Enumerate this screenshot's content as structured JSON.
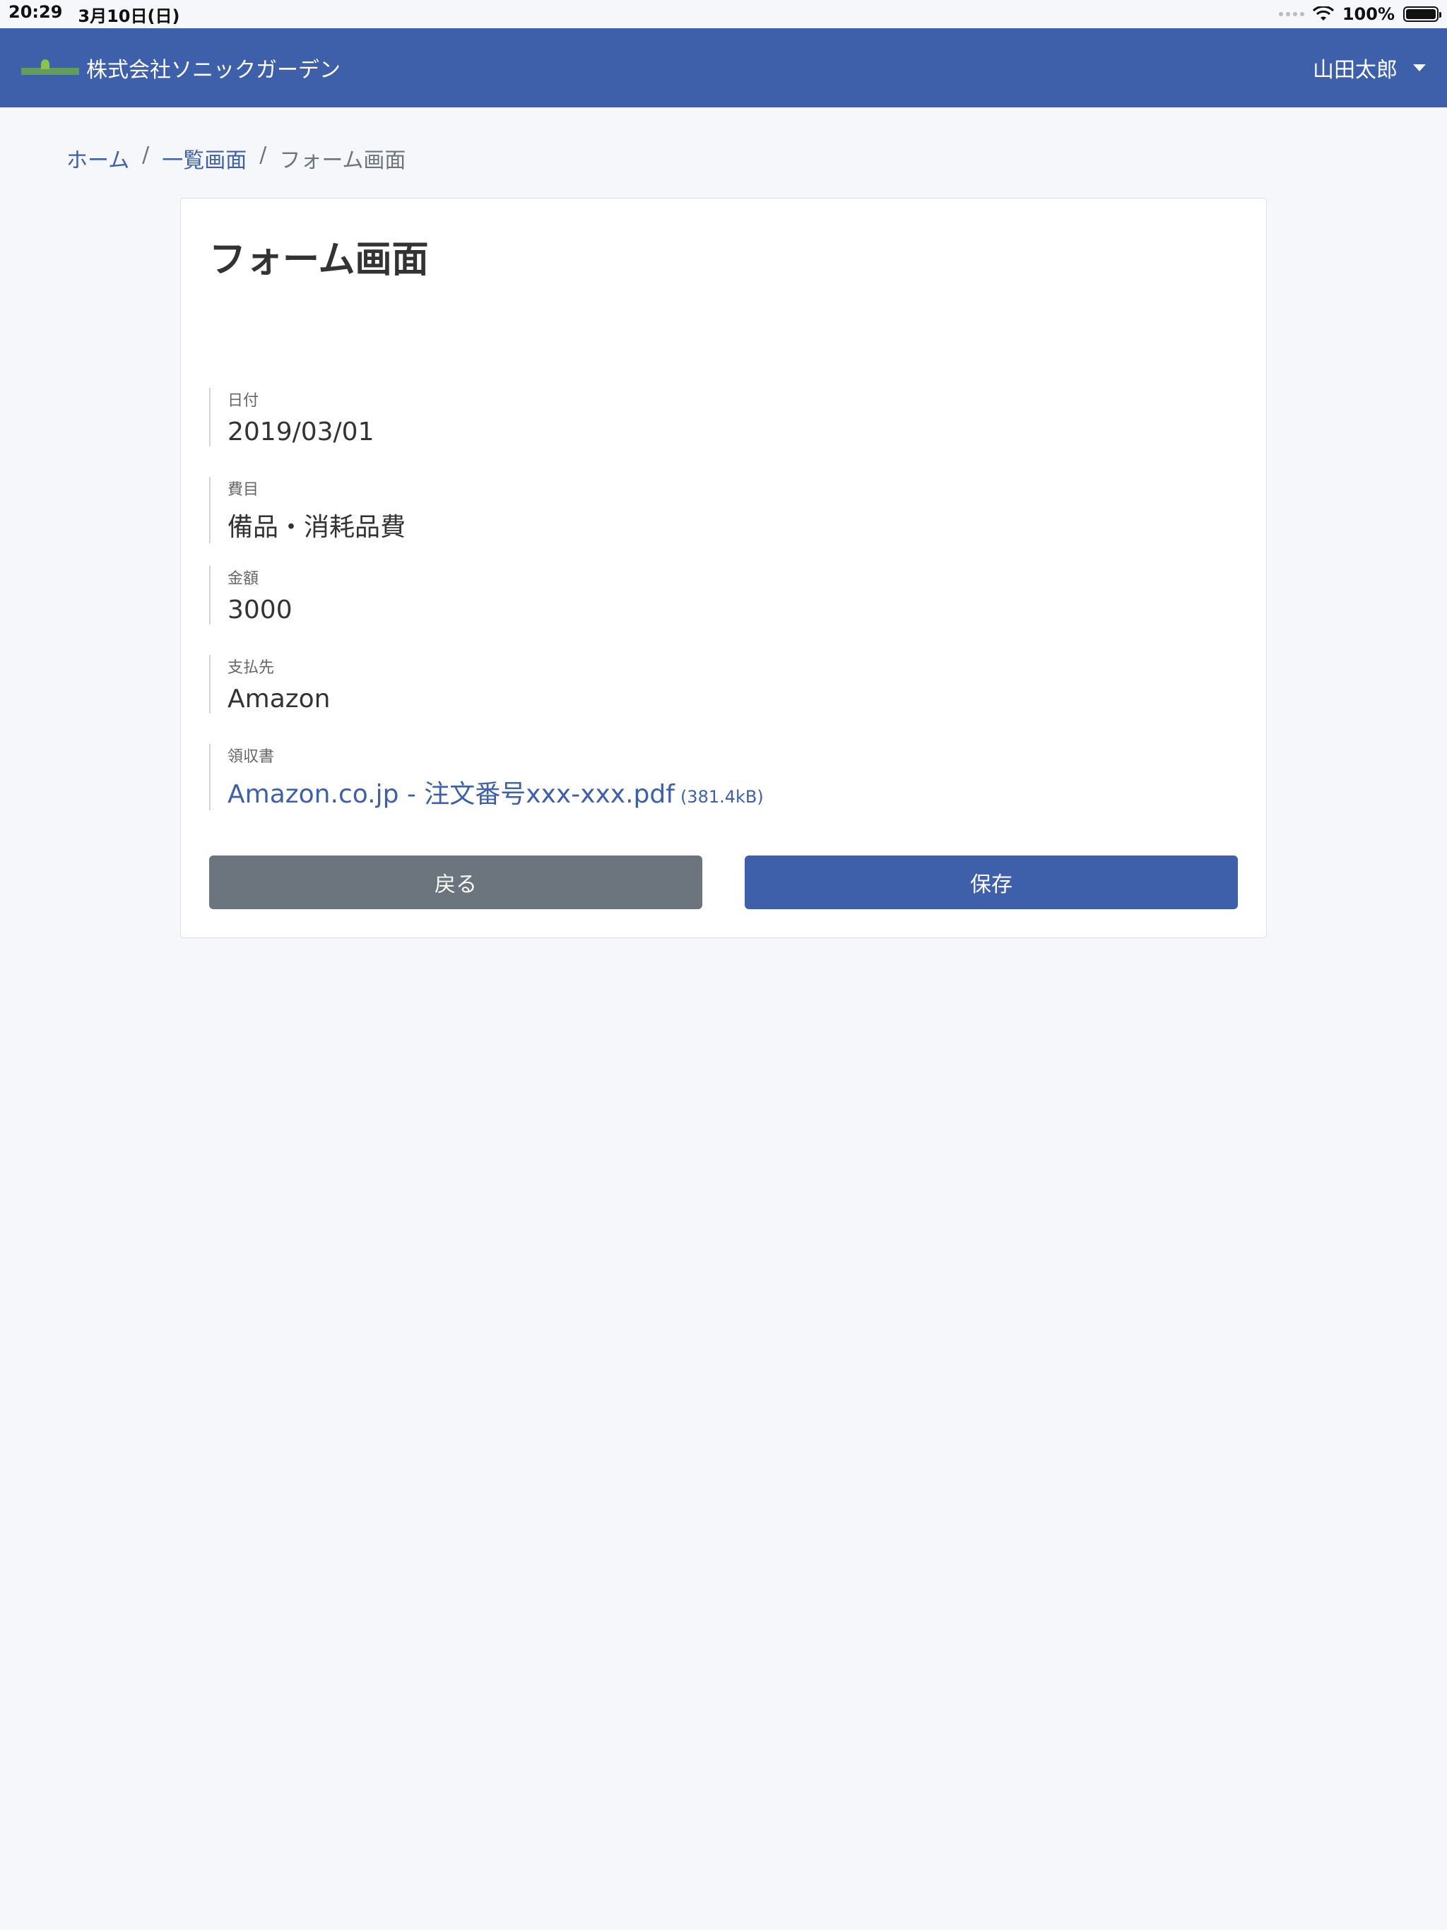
{
  "status": {
    "time": "20:29",
    "date": "3月10日(日)",
    "battery": "100%"
  },
  "navbar": {
    "brand_name": "株式会社ソニックガーデン",
    "user_name": "山田太郎"
  },
  "breadcrumb": {
    "home": "ホーム",
    "list": "一覧画面",
    "current": "フォーム画面",
    "separator": "/"
  },
  "form": {
    "title": "フォーム画面",
    "fields": [
      {
        "label": "日付",
        "value": "2019/03/01"
      },
      {
        "label": "費目",
        "value": "備品・消耗品費"
      },
      {
        "label": "金額",
        "value": "3000"
      },
      {
        "label": "支払先",
        "value": "Amazon"
      },
      {
        "label": "領収書",
        "value": "Amazon.co.jp - 注文番号xxx-xxx.pdf",
        "size": "(381.4kB)"
      }
    ],
    "back_label": "戻る",
    "save_label": "保存"
  },
  "colors": {
    "primary": "#3e60ab",
    "secondary": "#6c757d",
    "background": "#f5f7fa"
  }
}
